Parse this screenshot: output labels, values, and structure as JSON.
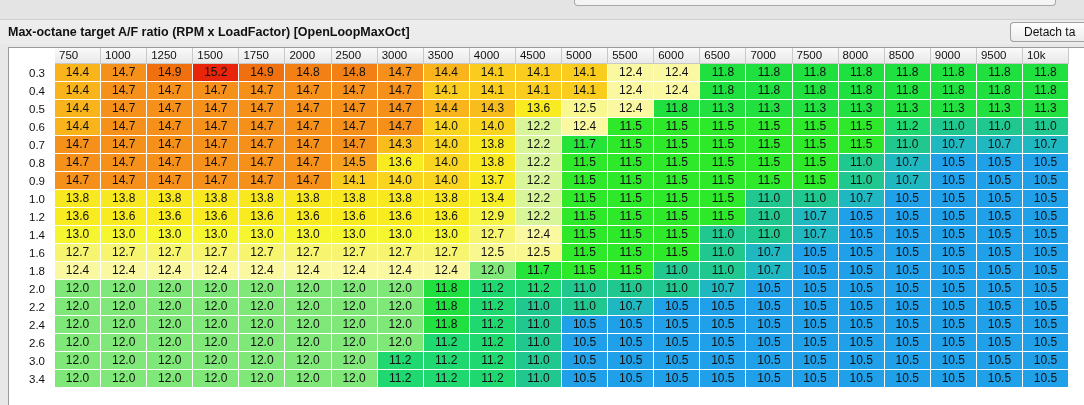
{
  "panel": {
    "title": "Max-octane target A/F ratio (RPM x LoadFactor) [OpenLoopMaxOct]",
    "detach_button": "Detach ta"
  },
  "table": {
    "columns": [
      "750",
      "1000",
      "1250",
      "1500",
      "1750",
      "2000",
      "2500",
      "3000",
      "3500",
      "4000",
      "4500",
      "5000",
      "5500",
      "6000",
      "6500",
      "7000",
      "7500",
      "8000",
      "8500",
      "9000",
      "9500",
      "10k"
    ],
    "rows": [
      {
        "label": "0.3",
        "cells": [
          "14.4",
          "14.7",
          "14.9",
          "15.2",
          "14.9",
          "14.8",
          "14.8",
          "14.7",
          "14.4",
          "14.1",
          "14.1",
          "14.1",
          "12.4",
          "12.4",
          "11.8",
          "11.8",
          "11.8",
          "11.8",
          "11.8",
          "11.8",
          "11.8",
          "11.8"
        ]
      },
      {
        "label": "0.4",
        "cells": [
          "14.4",
          "14.7",
          "14.7",
          "14.7",
          "14.7",
          "14.7",
          "14.7",
          "14.7",
          "14.1",
          "14.1",
          "14.1",
          "14.1",
          "12.4",
          "12.4",
          "11.8",
          "11.8",
          "11.8",
          "11.8",
          "11.8",
          "11.8",
          "11.8",
          "11.8"
        ]
      },
      {
        "label": "0.5",
        "cells": [
          "14.4",
          "14.7",
          "14.7",
          "14.7",
          "14.7",
          "14.7",
          "14.7",
          "14.7",
          "14.4",
          "14.3",
          "13.6",
          "12.5",
          "12.4",
          "11.8",
          "11.3",
          "11.3",
          "11.3",
          "11.3",
          "11.3",
          "11.3",
          "11.3",
          "11.3"
        ]
      },
      {
        "label": "0.6",
        "cells": [
          "14.4",
          "14.7",
          "14.7",
          "14.7",
          "14.7",
          "14.7",
          "14.7",
          "14.7",
          "14.0",
          "14.0",
          "12.2",
          "12.4",
          "11.5",
          "11.5",
          "11.5",
          "11.5",
          "11.5",
          "11.5",
          "11.2",
          "11.0",
          "11.0",
          "11.0"
        ]
      },
      {
        "label": "0.7",
        "cells": [
          "14.7",
          "14.7",
          "14.7",
          "14.7",
          "14.7",
          "14.7",
          "14.7",
          "14.3",
          "14.0",
          "13.8",
          "12.2",
          "11.7",
          "11.5",
          "11.5",
          "11.5",
          "11.5",
          "11.5",
          "11.5",
          "11.0",
          "10.7",
          "10.7",
          "10.7"
        ]
      },
      {
        "label": "0.8",
        "cells": [
          "14.7",
          "14.7",
          "14.7",
          "14.7",
          "14.7",
          "14.7",
          "14.5",
          "13.6",
          "14.0",
          "13.8",
          "12.2",
          "11.5",
          "11.5",
          "11.5",
          "11.5",
          "11.5",
          "11.5",
          "11.0",
          "10.7",
          "10.5",
          "10.5",
          "10.5"
        ]
      },
      {
        "label": "0.9",
        "cells": [
          "14.7",
          "14.7",
          "14.7",
          "14.7",
          "14.7",
          "14.7",
          "14.1",
          "14.0",
          "14.0",
          "13.7",
          "12.2",
          "11.5",
          "11.5",
          "11.5",
          "11.5",
          "11.5",
          "11.5",
          "11.0",
          "10.7",
          "10.5",
          "10.5",
          "10.5"
        ]
      },
      {
        "label": "1.0",
        "cells": [
          "13.8",
          "13.8",
          "13.8",
          "13.8",
          "13.8",
          "13.8",
          "13.8",
          "13.8",
          "13.8",
          "13.4",
          "12.2",
          "11.5",
          "11.5",
          "11.5",
          "11.5",
          "11.0",
          "11.0",
          "10.7",
          "10.5",
          "10.5",
          "10.5",
          "10.5"
        ]
      },
      {
        "label": "1.2",
        "cells": [
          "13.6",
          "13.6",
          "13.6",
          "13.6",
          "13.6",
          "13.6",
          "13.6",
          "13.6",
          "13.6",
          "12.9",
          "12.2",
          "11.5",
          "11.5",
          "11.5",
          "11.5",
          "11.0",
          "10.7",
          "10.5",
          "10.5",
          "10.5",
          "10.5",
          "10.5"
        ]
      },
      {
        "label": "1.4",
        "cells": [
          "13.0",
          "13.0",
          "13.0",
          "13.0",
          "13.0",
          "13.0",
          "13.0",
          "13.0",
          "13.0",
          "12.7",
          "12.4",
          "11.5",
          "11.5",
          "11.5",
          "11.0",
          "11.0",
          "10.7",
          "10.5",
          "10.5",
          "10.5",
          "10.5",
          "10.5"
        ]
      },
      {
        "label": "1.6",
        "cells": [
          "12.7",
          "12.7",
          "12.7",
          "12.7",
          "12.7",
          "12.7",
          "12.7",
          "12.7",
          "12.7",
          "12.5",
          "12.5",
          "11.5",
          "11.5",
          "11.5",
          "11.0",
          "10.7",
          "10.5",
          "10.5",
          "10.5",
          "10.5",
          "10.5",
          "10.5"
        ]
      },
      {
        "label": "1.8",
        "cells": [
          "12.4",
          "12.4",
          "12.4",
          "12.4",
          "12.4",
          "12.4",
          "12.4",
          "12.4",
          "12.4",
          "12.0",
          "11.7",
          "11.5",
          "11.5",
          "11.0",
          "11.0",
          "10.7",
          "10.5",
          "10.5",
          "10.5",
          "10.5",
          "10.5",
          "10.5"
        ]
      },
      {
        "label": "2.0",
        "cells": [
          "12.0",
          "12.0",
          "12.0",
          "12.0",
          "12.0",
          "12.0",
          "12.0",
          "12.0",
          "11.8",
          "11.2",
          "11.2",
          "11.0",
          "11.0",
          "11.0",
          "10.7",
          "10.5",
          "10.5",
          "10.5",
          "10.5",
          "10.5",
          "10.5",
          "10.5"
        ]
      },
      {
        "label": "2.2",
        "cells": [
          "12.0",
          "12.0",
          "12.0",
          "12.0",
          "12.0",
          "12.0",
          "12.0",
          "12.0",
          "11.8",
          "11.2",
          "11.0",
          "11.0",
          "10.7",
          "10.5",
          "10.5",
          "10.5",
          "10.5",
          "10.5",
          "10.5",
          "10.5",
          "10.5",
          "10.5"
        ]
      },
      {
        "label": "2.4",
        "cells": [
          "12.0",
          "12.0",
          "12.0",
          "12.0",
          "12.0",
          "12.0",
          "12.0",
          "12.0",
          "11.8",
          "11.2",
          "11.0",
          "10.5",
          "10.5",
          "10.5",
          "10.5",
          "10.5",
          "10.5",
          "10.5",
          "10.5",
          "10.5",
          "10.5",
          "10.5"
        ]
      },
      {
        "label": "2.6",
        "cells": [
          "12.0",
          "12.0",
          "12.0",
          "12.0",
          "12.0",
          "12.0",
          "12.0",
          "12.0",
          "11.2",
          "11.2",
          "11.0",
          "10.5",
          "10.5",
          "10.5",
          "10.5",
          "10.5",
          "10.5",
          "10.5",
          "10.5",
          "10.5",
          "10.5",
          "10.5"
        ]
      },
      {
        "label": "3.0",
        "cells": [
          "12.0",
          "12.0",
          "12.0",
          "12.0",
          "12.0",
          "12.0",
          "12.0",
          "11.2",
          "11.2",
          "11.2",
          "11.0",
          "10.5",
          "10.5",
          "10.5",
          "10.5",
          "10.5",
          "10.5",
          "10.5",
          "10.5",
          "10.5",
          "10.5",
          "10.5"
        ]
      },
      {
        "label": "3.4",
        "cells": [
          "12.0",
          "12.0",
          "12.0",
          "12.0",
          "12.0",
          "12.0",
          "12.0",
          "11.2",
          "11.2",
          "11.2",
          "11.0",
          "10.5",
          "10.5",
          "10.5",
          "10.5",
          "10.5",
          "10.5",
          "10.5",
          "10.5",
          "10.5",
          "10.5",
          "10.5"
        ]
      }
    ]
  }
}
